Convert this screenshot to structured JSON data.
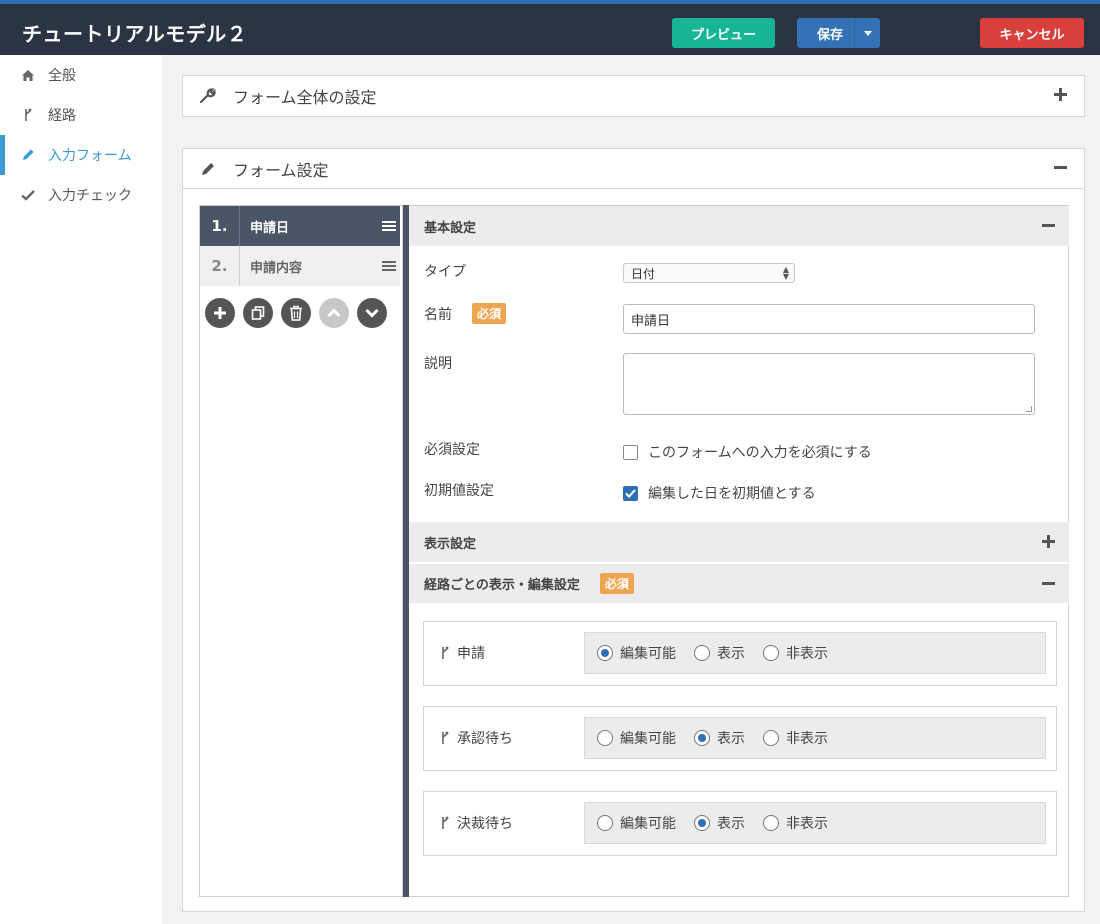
{
  "app": {
    "title": "チュートリアルモデル２",
    "buttons": {
      "preview": "プレビュー",
      "save": "保存",
      "cancel": "キャンセル"
    }
  },
  "sidebar": {
    "items": [
      {
        "label": "全般",
        "icon": "home-icon"
      },
      {
        "label": "経路",
        "icon": "route-icon"
      },
      {
        "label": "入力フォーム",
        "icon": "pencil-icon",
        "active": true
      },
      {
        "label": "入力チェック",
        "icon": "check-icon"
      }
    ]
  },
  "panels": {
    "global": {
      "title": "フォーム全体の設定",
      "icon": "wrench-icon"
    },
    "form": {
      "title": "フォーム設定",
      "icon": "pencil-icon"
    }
  },
  "fields": [
    {
      "num": "1.",
      "label": "申請日",
      "selected": true
    },
    {
      "num": "2.",
      "label": "申請内容",
      "selected": false
    }
  ],
  "tools": [
    "add-icon",
    "copy-icon",
    "trash-icon",
    "move-up-icon",
    "move-down-icon"
  ],
  "basic": {
    "title": "基本設定",
    "type_label": "タイプ",
    "type_value": "日付",
    "name_label": "名前",
    "required_badge": "必須",
    "name_value": "申請日",
    "desc_label": "説明",
    "required_label": "必須設定",
    "required_text": "このフォームへの入力を必須にする",
    "initial_label": "初期値設定",
    "initial_text": "編集した日を初期値とする"
  },
  "display": {
    "title": "表示設定"
  },
  "route_settings": {
    "title": "経路ごとの表示・編集設定",
    "badge": "必須",
    "option_labels": [
      "編集可能",
      "表示",
      "非表示"
    ],
    "routes": [
      {
        "name": "申請",
        "selected": 0
      },
      {
        "name": "承認待ち",
        "selected": 1
      },
      {
        "name": "決裁待ち",
        "selected": 1
      }
    ]
  },
  "colors": {
    "header": "#2b3443",
    "preview": "#16b596",
    "save": "#3472b5",
    "cancel": "#d9403c",
    "active": "#3b9ad6",
    "badge": "#eea54f"
  }
}
